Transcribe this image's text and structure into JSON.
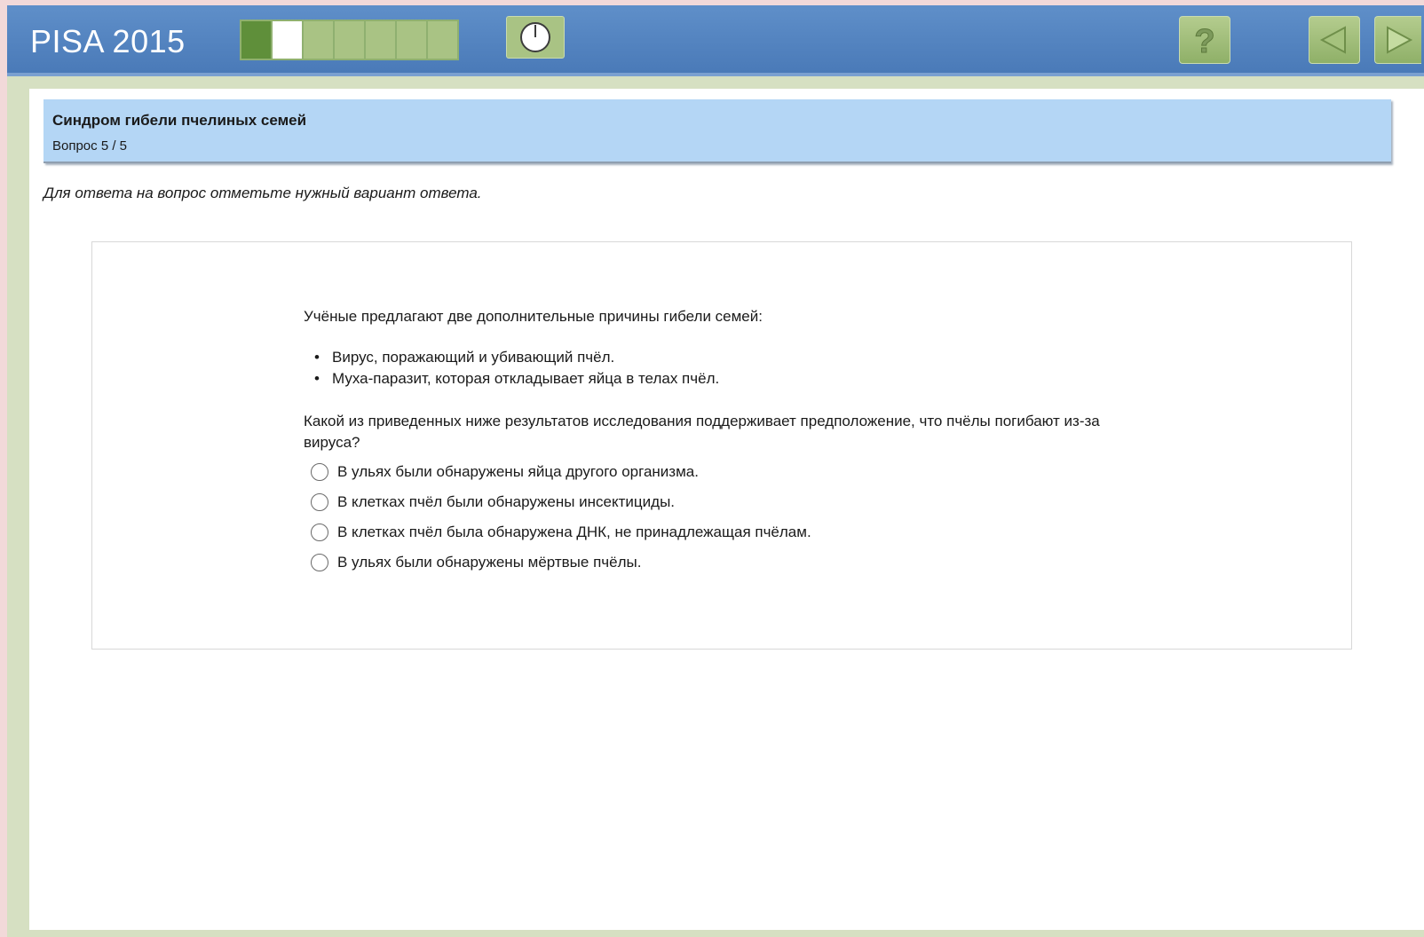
{
  "header": {
    "brand": "PISA 2015",
    "progress": {
      "total": 7,
      "done": 1,
      "current": 2
    },
    "icons": {
      "timer": "timer-icon",
      "help": "question-mark-icon",
      "prev": "arrow-left-icon",
      "next": "arrow-right-icon"
    },
    "colors": {
      "bar": "#4a7ab8",
      "button": "#a9c384",
      "progress_done": "#5f8f3a"
    }
  },
  "question_header": {
    "title": "Синдром гибели пчелиных семей",
    "count": "Вопрос 5 / 5"
  },
  "instruction": "Для ответа на вопрос отметьте нужный вариант ответа.",
  "content": {
    "intro": "Учёные предлагают две дополнительные причины гибели семей:",
    "bullets": [
      "Вирус, поражающий и убивающий пчёл.",
      "Муха-паразит, которая откладывает яйца в телах пчёл."
    ],
    "question": "Какой из приведенных ниже результатов исследования поддерживает предположение, что пчёлы погибают из-за вируса?",
    "options": [
      "В ульях были обнаружены яйца другого организма.",
      "В клетках пчёл были обнаружены инсектициды.",
      "В клетках пчёл была обнаружена ДНК, не принадлежащая пчёлам.",
      "В ульях были обнаружены мёртвые пчёлы."
    ]
  }
}
